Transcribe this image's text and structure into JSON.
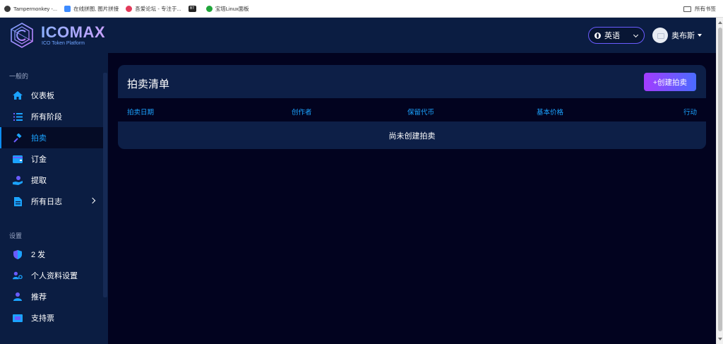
{
  "bookmarks": [
    {
      "label": "Tampermonkey -...",
      "icon": "tampermonkey-icon",
      "color": "#3a3a3a"
    },
    {
      "label": "在线拼图, 图片拼接",
      "icon": "puzzle-icon",
      "color": "#3d8bff"
    },
    {
      "label": "吾爱论坛 - 专注于...",
      "icon": "forum-icon",
      "color": "#e23b5a"
    },
    {
      "label": "",
      "icon": "bt-icon",
      "color": "#222222",
      "badge": "BT"
    },
    {
      "label": "宝塔Linux面板",
      "icon": "baota-icon",
      "color": "#20a53a"
    }
  ],
  "bookmarks_right": {
    "label": "所有书签",
    "icon": "folder-icon"
  },
  "brand": {
    "title": "ICOMAX",
    "subtitle": "ICO Token Platform"
  },
  "header": {
    "language": "英语",
    "user_name": "奥布斯"
  },
  "sidebar": {
    "section_general": "一般的",
    "section_settings": "设置",
    "items": [
      {
        "label": "仪表板",
        "icon": "home-icon"
      },
      {
        "label": "所有阶段",
        "icon": "list-icon"
      },
      {
        "label": "拍卖",
        "icon": "gavel-icon",
        "active": true
      },
      {
        "label": "订金",
        "icon": "wallet-icon"
      },
      {
        "label": "提取",
        "icon": "withdraw-icon"
      },
      {
        "label": "所有日志",
        "icon": "document-icon",
        "has_submenu": true
      },
      {
        "label": "2 发",
        "icon": "shield-icon"
      },
      {
        "label": "个人资料设置",
        "icon": "user-gear-icon"
      },
      {
        "label": "推荐",
        "icon": "user-icon"
      },
      {
        "label": "支持票",
        "icon": "ticket-icon"
      }
    ]
  },
  "auction": {
    "title": "拍卖清单",
    "create_button": "+创建拍卖",
    "columns": [
      "拍卖日期",
      "创作者",
      "保留代币",
      "基本价格",
      "行动"
    ],
    "empty_message": "尚未创建拍卖"
  },
  "colors": {
    "accent": "#1ba3ff",
    "sidebar_bg": "#0b1d42",
    "page_bg": "#02031f",
    "button_gradient_start": "#a33cff",
    "button_gradient_end": "#4a6bff"
  }
}
